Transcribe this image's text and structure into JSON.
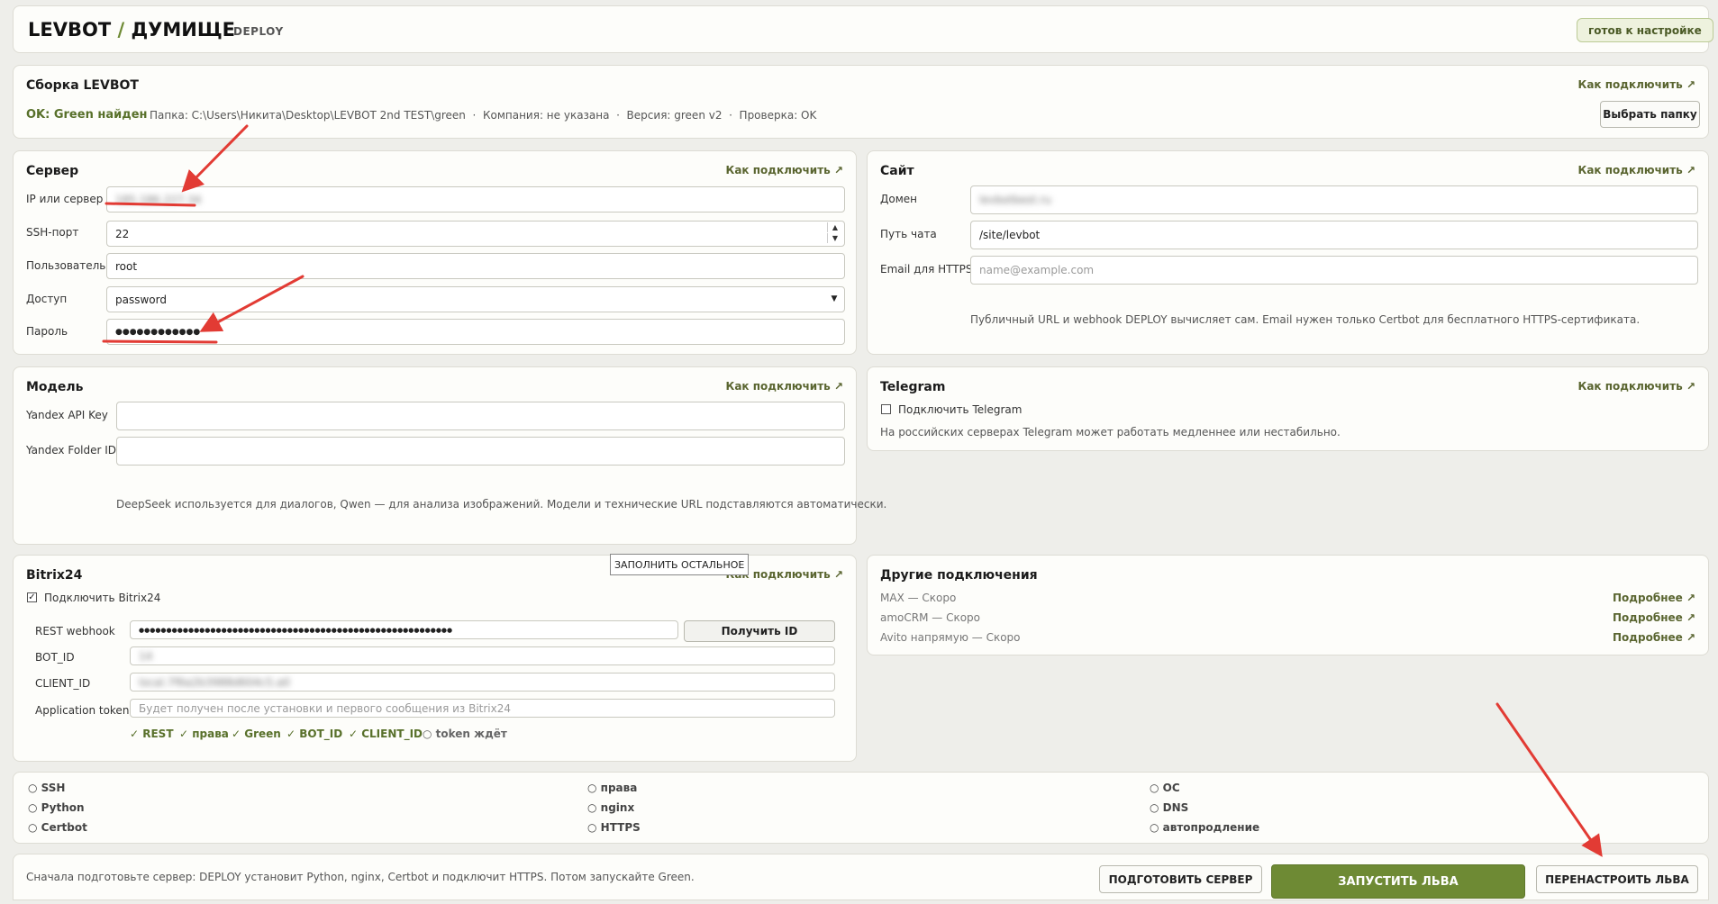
{
  "header": {
    "brand": "LEVBOT",
    "slash": "/",
    "title": "ДУМИЩЕ",
    "subtitle": "DEPLOY",
    "status_badge": "готов к настройке"
  },
  "build": {
    "title": "Сборка LEVBOT",
    "link": "Как подключить ↗",
    "status": "OK: Green найден",
    "details": "Папка: C:\\Users\\Никита\\Desktop\\LEVBOT 2nd TEST\\green  ·  Компания: не указана  ·  Версия: green v2  ·  Проверка: OK",
    "choose_folder": "Выбрать папку"
  },
  "server": {
    "title": "Сервер",
    "link": "Как подключить ↗",
    "ip_label": "IP или сервер",
    "ip_value": "185.186.227.34",
    "port_label": "SSH-порт",
    "port_value": "22",
    "user_label": "Пользователь",
    "user_value": "root",
    "access_label": "Доступ",
    "access_value": "password",
    "password_label": "Пароль",
    "password_value": "●●●●●●●●●●●●"
  },
  "site": {
    "title": "Сайт",
    "link": "Как подключить ↗",
    "domain_label": "Домен",
    "domain_value": "levbotbest.ru",
    "path_label": "Путь чата",
    "path_value": "/site/levbot",
    "email_label": "Email для HTTPS",
    "email_placeholder": "name@example.com",
    "note": "Публичный URL и webhook DEPLOY вычисляет сам. Email нужен только Certbot для бесплатного HTTPS-сертификата."
  },
  "model": {
    "title": "Модель",
    "link": "Как подключить ↗",
    "api_key_label": "Yandex API Key",
    "folder_label": "Yandex Folder ID",
    "note": "DeepSeek используется для диалогов, Qwen — для анализа изображений. Модели и технические URL подставляются автоматически."
  },
  "telegram": {
    "title": "Telegram",
    "link": "Как подключить ↗",
    "checkbox_label": "Подключить Telegram",
    "note": "На российских серверах Telegram может работать медленнее или нестабильно."
  },
  "bitrix": {
    "title": "Bitrix24",
    "link": "Как подключить ↗",
    "tooltip": "ЗАПОЛНИТЬ ОСТАЛЬНОЕ",
    "checkbox_label": "Подключить Bitrix24",
    "webhook_label": "REST webhook",
    "webhook_value": "●●●●●●●●●●●●●●●●●●●●●●●●●●●●●●●●●●●●●●●●●●●●●●●●●●●●●●●●●",
    "get_id_button": "Получить ID",
    "bot_id_label": "BOT_ID",
    "bot_id_value": "14",
    "client_id_label": "CLIENT_ID",
    "client_id_value": "local.7f6a2b3988d604c5.a0",
    "app_token_label": "Application token",
    "app_token_placeholder": "Будет получен после установки и первого сообщения из Bitrix24",
    "checks": [
      "✓ REST",
      "✓ права",
      "✓ Green",
      "✓ BOT_ID",
      "✓ CLIENT_ID",
      "○ token ждёт"
    ]
  },
  "other": {
    "title": "Другие подключения",
    "items": [
      {
        "label": "MAX — Скоро",
        "link": "Подробнее ↗"
      },
      {
        "label": "amoCRM — Скоро",
        "link": "Подробнее ↗"
      },
      {
        "label": "Avito напрямую — Скоро",
        "link": "Подробнее ↗"
      }
    ]
  },
  "status": {
    "col1": [
      "○ SSH",
      "○ Python",
      "○ Certbot"
    ],
    "col2": [
      "○ права",
      "○ nginx",
      "○ HTTPS"
    ],
    "col3": [
      "○ ОС",
      "○ DNS",
      "○ автопродление"
    ]
  },
  "footer": {
    "hint": "Сначала подготовьте сервер: DEPLOY установит Python, nginx, Certbot и подключит HTTPS. Потом запускайте Green.",
    "prepare_button": "ПОДГОТОВИТЬ СЕРВЕР",
    "launch_button": "ЗАПУСТИТЬ ЛЬВА",
    "reconfigure_button": "ПЕРЕНАСТРОИТЬ ЛЬВА"
  },
  "colors": {
    "accent_green": "#6e8a34",
    "annotation_red": "#e23b34"
  }
}
